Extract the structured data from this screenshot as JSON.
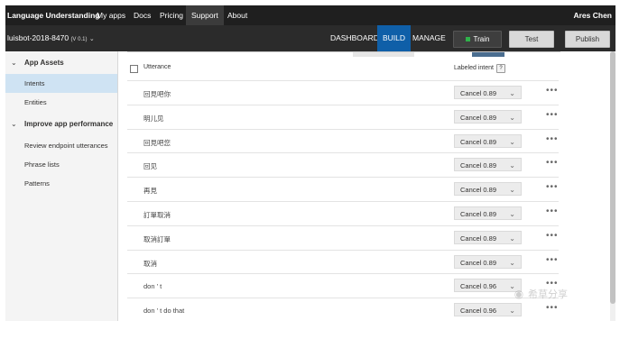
{
  "topnav": {
    "brand": "Language Understanding",
    "items": [
      "My apps",
      "Docs",
      "Pricing",
      "Support",
      "About"
    ],
    "active": "Support",
    "user": "Ares Chen"
  },
  "appbar": {
    "app_name": "luisbot-2018-8470",
    "version": "(V 0.1)",
    "tabs": [
      "DASHBOARD",
      "BUILD",
      "MANAGE"
    ],
    "active_tab": "BUILD",
    "train_label": "Train",
    "test_label": "Test",
    "publish_label": "Publish",
    "train_status_color": "#2fb24a"
  },
  "sidebar": {
    "groups": [
      {
        "label": "App Assets",
        "items": [
          "Intents",
          "Entities"
        ]
      },
      {
        "label": "Improve app performance",
        "items": [
          "Review endpoint utterances",
          "Phrase lists",
          "Patterns"
        ]
      }
    ],
    "active_item": "Intents"
  },
  "table": {
    "col_utterance": "Utterance",
    "col_intent": "Labeled intent",
    "help": "?",
    "rows": [
      {
        "utterance": "回見吧你",
        "intent": "Cancel 0.89"
      },
      {
        "utterance": "明儿见",
        "intent": "Cancel 0.89"
      },
      {
        "utterance": "回見吧您",
        "intent": "Cancel 0.89"
      },
      {
        "utterance": "回见",
        "intent": "Cancel 0.89"
      },
      {
        "utterance": "再見",
        "intent": "Cancel 0.89"
      },
      {
        "utterance": "訂單取消",
        "intent": "Cancel 0.89"
      },
      {
        "utterance": "取消訂單",
        "intent": "Cancel 0.89"
      },
      {
        "utterance": "取消",
        "intent": "Cancel 0.89"
      },
      {
        "utterance": "don ' t",
        "intent": "Cancel 0.96"
      },
      {
        "utterance": "don ' t do that",
        "intent": "Cancel 0.96"
      }
    ]
  },
  "watermark": "希草分享",
  "colors": {
    "accent": "#0f5fa8",
    "nav_bg": "#1f1f1f",
    "appbar_bg": "#2b2b2b",
    "active_sidebar": "#cfe3f3"
  }
}
